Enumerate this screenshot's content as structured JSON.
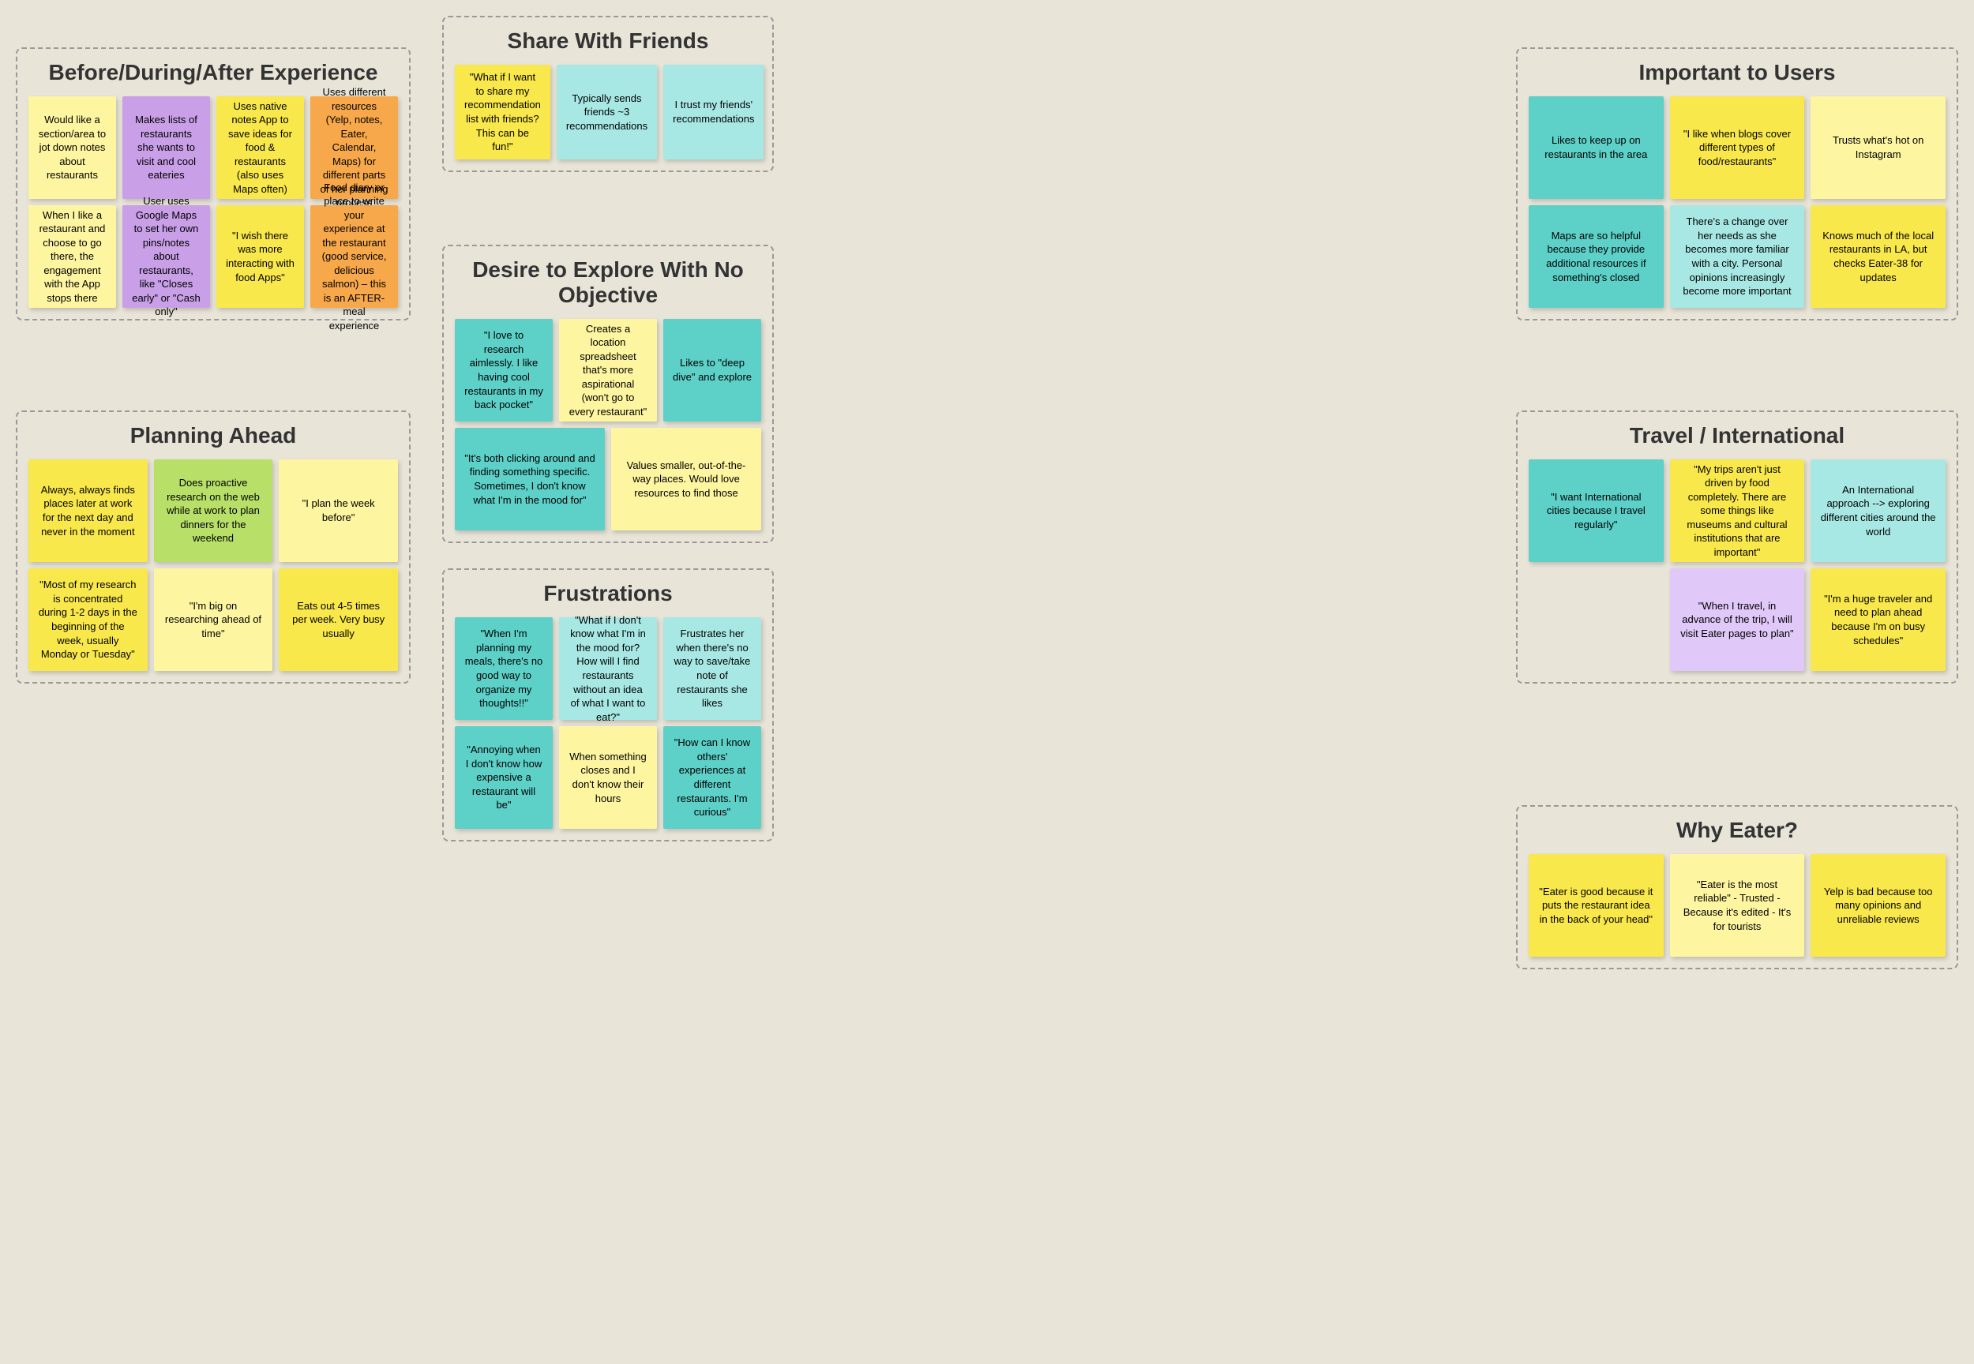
{
  "sections": {
    "bda": {
      "title": "Before/During/After Experience",
      "row1": [
        {
          "text": "Would like a section/area to jot down notes about restaurants",
          "color": "light-yellow"
        },
        {
          "text": "Makes lists of restaurants she wants to visit and cool eateries",
          "color": "purple"
        },
        {
          "text": "Uses native notes App to save ideas for food & restaurants (also uses Maps often)",
          "color": "yellow"
        },
        {
          "text": "Uses different resources (Yelp, notes, Eater, Calendar, Maps) for different parts of her planning process",
          "color": "orange"
        }
      ],
      "row2": [
        {
          "text": "When I like a restaurant and choose to go there, the engagement with the App stops there",
          "color": "light-yellow"
        },
        {
          "text": "User uses Google Maps to set her own pins/notes about restaurants, like \"Closes early\" or \"Cash only\"",
          "color": "purple"
        },
        {
          "text": "\"I wish there was more interacting with food Apps\"",
          "color": "yellow"
        },
        {
          "text": "Food diary or place to write your experience at the restaurant (good service, delicious salmon) – this is an AFTER-meal experience",
          "color": "orange"
        }
      ]
    },
    "swf": {
      "title": "Share With Friends",
      "items": [
        {
          "text": "\"What if I want to share my recommendation list with friends? This can be fun!\"",
          "color": "yellow"
        },
        {
          "text": "Typically sends friends ~3 recommendations",
          "color": "light-teal"
        },
        {
          "text": "I trust my friends' recommendations",
          "color": "light-teal"
        }
      ]
    },
    "itu": {
      "title": "Important to Users",
      "row1": [
        {
          "text": "Likes to keep up on restaurants in the area",
          "color": "teal"
        },
        {
          "text": "\"I like when blogs cover different types of food/restaurants\"",
          "color": "yellow"
        },
        {
          "text": "Trusts what's hot on Instagram",
          "color": "light-yellow"
        }
      ],
      "row2": [
        {
          "text": "Maps are so helpful because they provide additional resources if something's closed",
          "color": "teal"
        },
        {
          "text": "There's a change over her needs as she becomes more familiar with a city. Personal opinions increasingly become more important",
          "color": "light-teal"
        },
        {
          "text": "Knows much of the local restaurants in LA, but checks Eater-38 for updates",
          "color": "yellow"
        }
      ]
    },
    "dte": {
      "title": "Desire to Explore With No Objective",
      "row1": [
        {
          "text": "\"I love to research aimlessly. I like having cool restaurants in my back pocket\"",
          "color": "teal"
        },
        {
          "text": "Creates a location spreadsheet that's more aspirational (won't go to every restaurant\"",
          "color": "light-yellow"
        },
        {
          "text": "Likes to \"deep dive\" and explore",
          "color": "teal"
        }
      ],
      "row2": [
        {
          "text": "\"It's both clicking around and finding something specific. Sometimes, I don't know what I'm in the mood for\"",
          "color": "teal"
        },
        {
          "text": "Values smaller, out-of-the-way places. Would love resources to find those",
          "color": "light-yellow"
        }
      ]
    },
    "pa": {
      "title": "Planning Ahead",
      "row1": [
        {
          "text": "Always, always finds places later at work for the next day and never in the moment",
          "color": "yellow"
        },
        {
          "text": "Does proactive research on the web while at work to plan dinners for the weekend",
          "color": "green"
        },
        {
          "text": "\"I plan the week before\"",
          "color": "light-yellow"
        }
      ],
      "row2": [
        {
          "text": "\"Most of my research is concentrated during 1-2 days in the beginning of the week, usually Monday or Tuesday\"",
          "color": "yellow"
        },
        {
          "text": "\"I'm big on researching ahead of time\"",
          "color": "light-yellow"
        },
        {
          "text": "Eats out 4-5 times per week. Very busy usually",
          "color": "yellow"
        }
      ]
    },
    "ti": {
      "title": "Travel / International",
      "row1": [
        {
          "text": "\"I want International cities because I travel regularly\"",
          "color": "teal"
        },
        {
          "text": "\"My trips aren't just driven by food completely. There are some things like museums and cultural institutions that are important\"",
          "color": "yellow"
        },
        {
          "text": "An International approach --> exploring different cities around the world",
          "color": "light-teal"
        }
      ],
      "row2": [
        {
          "text": "",
          "color": ""
        },
        {
          "text": "\"When I travel, in advance of the trip, I will visit Eater pages to plan\"",
          "color": "light-purple"
        },
        {
          "text": "\"I'm a huge traveler and need to plan ahead because I'm on busy schedules\"",
          "color": "yellow"
        }
      ]
    },
    "fr": {
      "title": "Frustrations",
      "row1": [
        {
          "text": "\"When I'm planning my meals, there's no good way to organize my thoughts!!\"",
          "color": "teal"
        },
        {
          "text": "\"What if I don't know what I'm in the mood for? How will I find restaurants without an idea of what I want to eat?\"",
          "color": "light-teal"
        },
        {
          "text": "Frustrates her when there's no way to save/take note of restaurants she likes",
          "color": "light-teal"
        }
      ],
      "row2": [
        {
          "text": "\"Annoying when I don't know how expensive a restaurant will be\"",
          "color": "teal"
        },
        {
          "text": "When something closes and I don't know their hours",
          "color": "light-yellow"
        },
        {
          "text": "\"How can I know others' experiences at different restaurants. I'm curious\"",
          "color": "teal"
        }
      ]
    },
    "we": {
      "title": "Why Eater?",
      "items": [
        {
          "text": "\"Eater is good because it puts the restaurant idea in the back of your head\"",
          "color": "yellow"
        },
        {
          "text": "\"Eater is the most reliable\" - Trusted - Because it's edited - It's for tourists",
          "color": "light-yellow"
        },
        {
          "text": "Yelp is bad because too many opinions and unreliable reviews",
          "color": "yellow"
        }
      ]
    }
  }
}
